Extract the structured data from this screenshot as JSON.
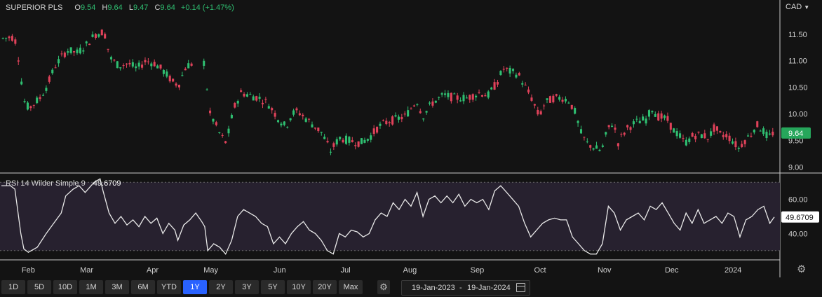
{
  "legend": {
    "symbol": "SUPERIOR PLS",
    "open_key": "O",
    "open_val": "9.54",
    "high_key": "H",
    "high_val": "9.64",
    "low_key": "L",
    "low_val": "9.47",
    "close_key": "C",
    "close_val": "9.64",
    "change": "+0.14 (+1.47%)"
  },
  "currency": "CAD",
  "rsi": {
    "label": "RSI 14 Wilder Simple 9",
    "value": "49.6709"
  },
  "toolbar": {
    "timeframes": [
      "1D",
      "5D",
      "10D",
      "1M",
      "3M",
      "6M",
      "YTD",
      "1Y",
      "2Y",
      "3Y",
      "5Y",
      "10Y",
      "20Y",
      "Max"
    ],
    "active": "1Y",
    "range_start": "19-Jan-2023",
    "range_sep": "-",
    "range_end": "19-Jan-2024"
  },
  "colors": {
    "up": "#2fbf71",
    "down": "#e0425a",
    "rsi_line": "#e8e8e8",
    "rsi_band": "#27212f",
    "active_button": "#2962ff"
  },
  "chart_data": [
    {
      "type": "candlestick",
      "title": "SUPERIOR PLS",
      "ylim": [
        8.9,
        11.8
      ],
      "yticks": [
        9.0,
        9.5,
        10.0,
        10.5,
        11.0,
        11.5
      ],
      "ytick_labels": [
        "9.00",
        "9.50",
        "10.00",
        "10.50",
        "11.00",
        "11.50"
      ],
      "last_price": 9.64,
      "last_price_label": "9.64",
      "xlim": [
        0,
        250
      ],
      "xticks": [
        {
          "x": 18,
          "label": "Feb"
        },
        {
          "x": 57,
          "label": "Mar"
        },
        {
          "x": 101,
          "label": "Apr"
        },
        {
          "x": 140,
          "label": "May"
        },
        {
          "x": 186,
          "label": "Jun"
        },
        {
          "x": 230,
          "label": "Jul"
        },
        {
          "x": 273,
          "label": "Aug"
        },
        {
          "x": 318,
          "label": "Sep"
        },
        {
          "x": 360,
          "label": "Oct"
        },
        {
          "x": 403,
          "label": "Nov"
        },
        {
          "x": 448,
          "label": "Dec"
        },
        {
          "x": 489,
          "label": "2024"
        }
      ],
      "trend_anchors": [
        [
          0,
          11.42
        ],
        [
          6,
          11.45
        ],
        [
          9,
          11.35
        ],
        [
          13,
          10.5
        ],
        [
          15,
          10.15
        ],
        [
          18,
          10.12
        ],
        [
          25,
          10.3
        ],
        [
          30,
          10.55
        ],
        [
          35,
          10.9
        ],
        [
          43,
          11.2
        ],
        [
          50,
          11.15
        ],
        [
          56,
          11.3
        ],
        [
          62,
          11.5
        ],
        [
          68,
          11.55
        ],
        [
          72,
          11.05
        ],
        [
          78,
          10.9
        ],
        [
          84,
          10.95
        ],
        [
          90,
          10.85
        ],
        [
          96,
          11.0
        ],
        [
          102,
          10.95
        ],
        [
          108,
          10.8
        ],
        [
          114,
          10.6
        ],
        [
          118,
          10.55
        ],
        [
          123,
          10.9
        ],
        [
          132,
          11.0
        ],
        [
          136,
          10.95
        ],
        [
          138,
          10.05
        ],
        [
          142,
          9.85
        ],
        [
          146,
          9.6
        ],
        [
          150,
          9.45
        ],
        [
          155,
          10.1
        ],
        [
          160,
          10.4
        ],
        [
          166,
          10.35
        ],
        [
          172,
          10.3
        ],
        [
          178,
          10.2
        ],
        [
          184,
          9.95
        ],
        [
          190,
          9.75
        ],
        [
          194,
          10.0
        ],
        [
          198,
          10.05
        ],
        [
          206,
          9.85
        ],
        [
          214,
          9.65
        ],
        [
          220,
          9.3
        ],
        [
          226,
          9.55
        ],
        [
          232,
          9.5
        ],
        [
          240,
          9.45
        ],
        [
          246,
          9.55
        ],
        [
          252,
          9.75
        ],
        [
          258,
          9.85
        ],
        [
          264,
          9.9
        ],
        [
          270,
          9.95
        ],
        [
          278,
          10.25
        ],
        [
          282,
          9.95
        ],
        [
          288,
          10.2
        ],
        [
          296,
          10.35
        ],
        [
          304,
          10.3
        ],
        [
          312,
          10.3
        ],
        [
          320,
          10.4
        ],
        [
          326,
          10.35
        ],
        [
          332,
          10.6
        ],
        [
          336,
          10.85
        ],
        [
          340,
          10.8
        ],
        [
          346,
          10.75
        ],
        [
          350,
          10.55
        ],
        [
          355,
          10.3
        ],
        [
          360,
          9.95
        ],
        [
          364,
          10.2
        ],
        [
          370,
          10.3
        ],
        [
          376,
          10.3
        ],
        [
          380,
          10.25
        ],
        [
          384,
          10.05
        ],
        [
          388,
          9.65
        ],
        [
          392,
          9.45
        ],
        [
          398,
          9.35
        ],
        [
          402,
          9.3
        ],
        [
          406,
          9.7
        ],
        [
          410,
          9.85
        ],
        [
          413,
          9.45
        ],
        [
          416,
          9.6
        ],
        [
          420,
          9.75
        ],
        [
          426,
          9.85
        ],
        [
          432,
          9.9
        ],
        [
          436,
          10.1
        ],
        [
          440,
          9.95
        ],
        [
          446,
          9.9
        ],
        [
          450,
          9.7
        ],
        [
          454,
          9.6
        ],
        [
          458,
          9.45
        ],
        [
          464,
          9.6
        ],
        [
          470,
          9.6
        ],
        [
          474,
          9.55
        ],
        [
          478,
          9.75
        ],
        [
          482,
          9.6
        ],
        [
          486,
          9.6
        ],
        [
          490,
          9.5
        ],
        [
          494,
          9.35
        ],
        [
          498,
          9.5
        ],
        [
          502,
          9.6
        ],
        [
          506,
          9.8
        ],
        [
          510,
          9.7
        ],
        [
          514,
          9.55
        ],
        [
          517,
          9.64
        ]
      ]
    },
    {
      "type": "line",
      "title": "RSI 14 Wilder Simple 9",
      "ylim": [
        25,
        75
      ],
      "yticks": [
        40,
        60
      ],
      "ytick_labels": [
        "40.00",
        "60.00"
      ],
      "band": [
        30,
        70
      ],
      "last_value": 49.6709,
      "last_value_label": "49.6709",
      "series": [
        {
          "name": "RSI 14 Wilder Simple 9",
          "points": [
            [
              0,
              68
            ],
            [
              6,
              68
            ],
            [
              9,
              66
            ],
            [
              13,
              40
            ],
            [
              15,
              31
            ],
            [
              18,
              29
            ],
            [
              24,
              32
            ],
            [
              30,
              40
            ],
            [
              35,
              46
            ],
            [
              40,
              52
            ],
            [
              43,
              62
            ],
            [
              48,
              66
            ],
            [
              52,
              68
            ],
            [
              56,
              64
            ],
            [
              62,
              70
            ],
            [
              66,
              72
            ],
            [
              68,
              65
            ],
            [
              72,
              52
            ],
            [
              76,
              46
            ],
            [
              80,
              50
            ],
            [
              84,
              45
            ],
            [
              88,
              48
            ],
            [
              92,
              44
            ],
            [
              96,
              50
            ],
            [
              100,
              46
            ],
            [
              104,
              49
            ],
            [
              108,
              40
            ],
            [
              112,
              46
            ],
            [
              116,
              42
            ],
            [
              118,
              36
            ],
            [
              122,
              45
            ],
            [
              126,
              48
            ],
            [
              130,
              52
            ],
            [
              134,
              47
            ],
            [
              136,
              44
            ],
            [
              138,
              30
            ],
            [
              142,
              34
            ],
            [
              146,
              32
            ],
            [
              150,
              28
            ],
            [
              154,
              36
            ],
            [
              158,
              50
            ],
            [
              162,
              54
            ],
            [
              166,
              52
            ],
            [
              170,
              50
            ],
            [
              174,
              46
            ],
            [
              178,
              44
            ],
            [
              182,
              34
            ],
            [
              186,
              38
            ],
            [
              190,
              34
            ],
            [
              194,
              40
            ],
            [
              198,
              44
            ],
            [
              202,
              47
            ],
            [
              206,
              42
            ],
            [
              210,
              40
            ],
            [
              214,
              36
            ],
            [
              218,
              30
            ],
            [
              222,
              28
            ],
            [
              226,
              40
            ],
            [
              230,
              38
            ],
            [
              234,
              42
            ],
            [
              238,
              41
            ],
            [
              242,
              38
            ],
            [
              246,
              40
            ],
            [
              250,
              48
            ],
            [
              254,
              52
            ],
            [
              258,
              50
            ],
            [
              262,
              58
            ],
            [
              266,
              54
            ],
            [
              270,
              60
            ],
            [
              274,
              56
            ],
            [
              278,
              64
            ],
            [
              282,
              50
            ],
            [
              286,
              60
            ],
            [
              290,
              62
            ],
            [
              294,
              58
            ],
            [
              298,
              62
            ],
            [
              302,
              58
            ],
            [
              306,
              63
            ],
            [
              310,
              56
            ],
            [
              314,
              60
            ],
            [
              318,
              58
            ],
            [
              322,
              60
            ],
            [
              326,
              54
            ],
            [
              330,
              65
            ],
            [
              334,
              68
            ],
            [
              338,
              64
            ],
            [
              342,
              60
            ],
            [
              346,
              56
            ],
            [
              350,
              46
            ],
            [
              354,
              38
            ],
            [
              358,
              42
            ],
            [
              362,
              46
            ],
            [
              366,
              48
            ],
            [
              370,
              49
            ],
            [
              374,
              48
            ],
            [
              378,
              48
            ],
            [
              382,
              38
            ],
            [
              386,
              34
            ],
            [
              390,
              30
            ],
            [
              394,
              28
            ],
            [
              398,
              28
            ],
            [
              402,
              34
            ],
            [
              406,
              56
            ],
            [
              410,
              52
            ],
            [
              414,
              42
            ],
            [
              418,
              48
            ],
            [
              422,
              50
            ],
            [
              426,
              52
            ],
            [
              430,
              48
            ],
            [
              434,
              56
            ],
            [
              438,
              54
            ],
            [
              442,
              58
            ],
            [
              446,
              52
            ],
            [
              450,
              46
            ],
            [
              454,
              42
            ],
            [
              458,
              52
            ],
            [
              462,
              46
            ],
            [
              466,
              54
            ],
            [
              470,
              46
            ],
            [
              474,
              48
            ],
            [
              478,
              50
            ],
            [
              482,
              46
            ],
            [
              486,
              52
            ],
            [
              490,
              50
            ],
            [
              494,
              38
            ],
            [
              498,
              48
            ],
            [
              502,
              50
            ],
            [
              506,
              54
            ],
            [
              510,
              56
            ],
            [
              514,
              46
            ],
            [
              517,
              49.67
            ]
          ]
        }
      ]
    }
  ]
}
